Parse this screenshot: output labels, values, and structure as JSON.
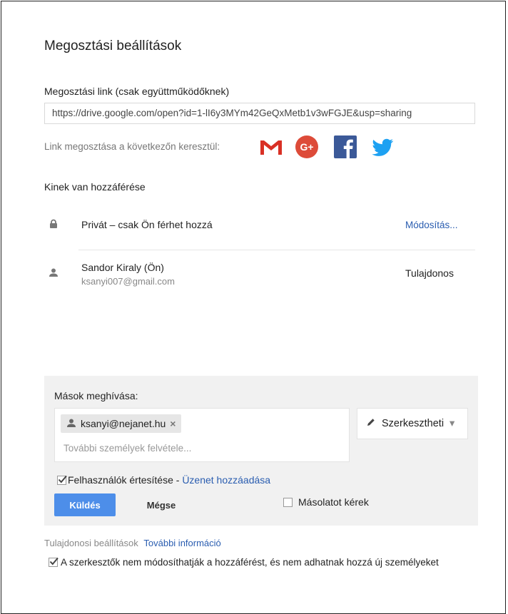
{
  "dialog": {
    "title": "Megosztási beállítások"
  },
  "share_link": {
    "label": "Megosztási link (csak együttműködőknek)",
    "value": "https://drive.google.com/open?id=1-lI6y3MYm42GeQxMetb1v3wFGJE&usp=sharing",
    "share_via_label": "Link megosztása a következőn keresztül:",
    "networks": [
      "gmail-icon",
      "google-plus-icon",
      "facebook-icon",
      "twitter-icon"
    ]
  },
  "access": {
    "heading": "Kinek van hozzáférése",
    "visibility": {
      "text": "Privát – csak Ön férhet hozzá",
      "change_link": "Módosítás..."
    },
    "owner": {
      "name": "Sandor Kiraly (Ön)",
      "email": "ksanyi007@gmail.com",
      "role": "Tulajdonos"
    }
  },
  "invite": {
    "label": "Mások meghívása:",
    "chip_email": "ksanyi@nejanet.hu",
    "chip_remove": "×",
    "placeholder": "További személyek felvétele...",
    "permission": "Szerkesztheti",
    "notify_label": "Felhasználók értesítése",
    "notify_separator": " - ",
    "add_message_link": "Üzenet hozzáadása",
    "notify_checked": true,
    "send_button": "Küldés",
    "cancel_button": "Mégse",
    "copy_label": "Másolatot kérek",
    "copy_checked": false
  },
  "owner_settings": {
    "label": "Tulajdonosi beállítások",
    "more_info_link": "További információ",
    "restriction_label": "A szerkesztők nem módosíthatják a hozzáférést, és nem adhatnak hozzá új személyeket",
    "restriction_checked": true
  },
  "colors": {
    "primary_button": "#4d8ee9",
    "link": "#2a5db0",
    "gmail_red": "#d93025",
    "google_plus": "#dd4b39",
    "facebook": "#3b5998",
    "twitter": "#1da1f2"
  }
}
